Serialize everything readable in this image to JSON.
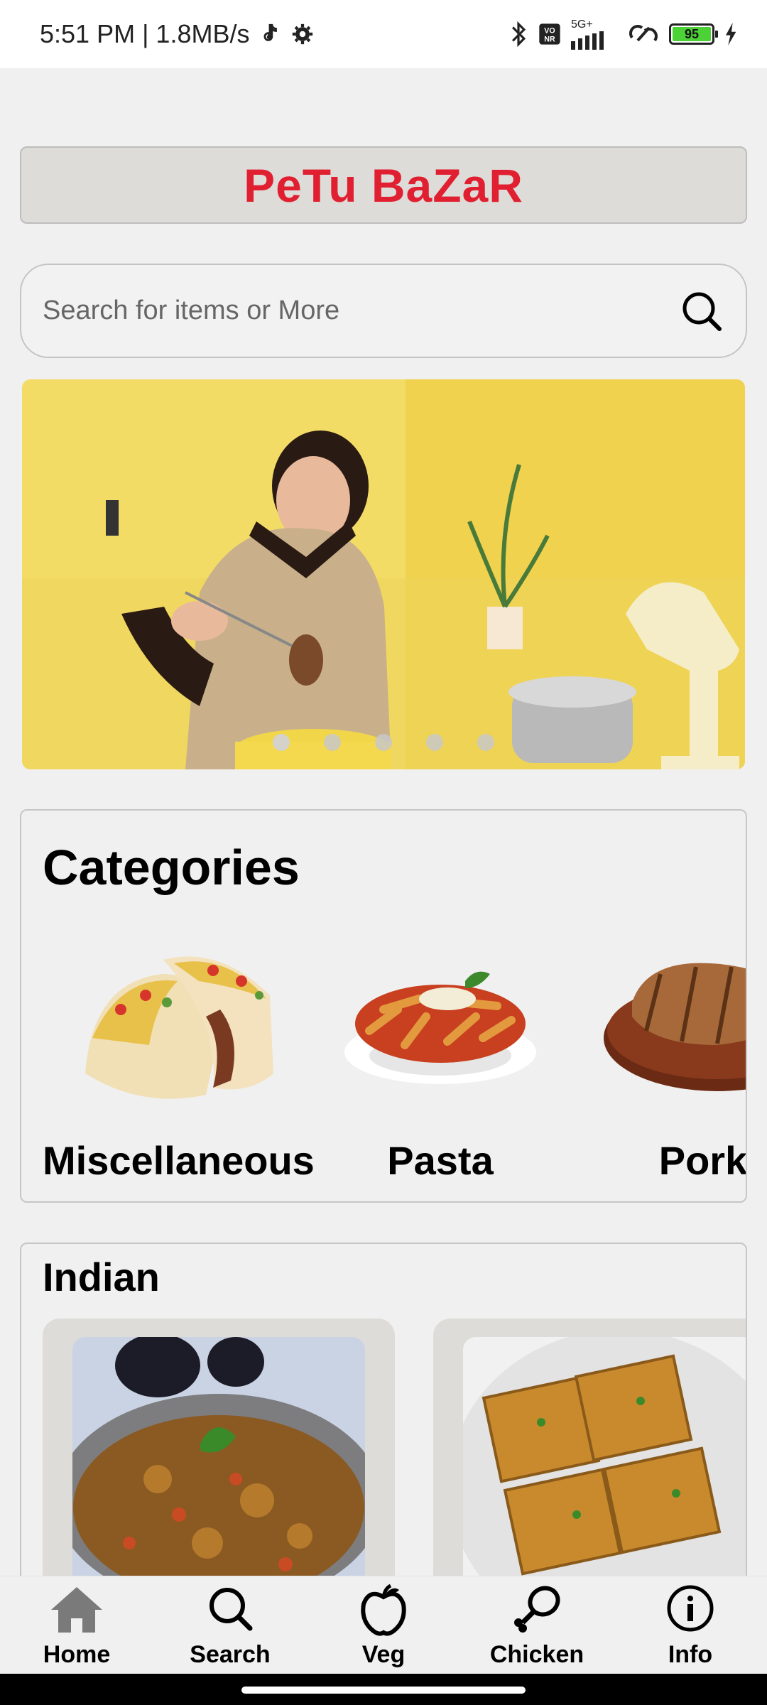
{
  "status_bar": {
    "time_speed": "5:51 PM | 1.8MB/s",
    "network": "5G+",
    "battery": "95"
  },
  "app": {
    "title": "PeTu BaZaR"
  },
  "search": {
    "placeholder": "Search for items or More"
  },
  "banner": {
    "slides": 5,
    "active_slide": 1
  },
  "categories": {
    "title": "Categories",
    "items": [
      {
        "label": "Miscellaneous",
        "icon": "taco-image"
      },
      {
        "label": "Pasta",
        "icon": "pasta-image"
      },
      {
        "label": "Pork",
        "icon": "pork-chop-image"
      }
    ]
  },
  "indian": {
    "title": "Indian",
    "items": [
      {
        "icon": "baingan-bharta-image"
      },
      {
        "icon": "bread-toast-image"
      }
    ]
  },
  "bottom_nav": {
    "items": [
      {
        "label": "Home",
        "icon": "home-icon"
      },
      {
        "label": "Search",
        "icon": "search-icon"
      },
      {
        "label": "Veg",
        "icon": "apple-icon"
      },
      {
        "label": "Chicken",
        "icon": "drumstick-icon"
      },
      {
        "label": "Info",
        "icon": "info-icon"
      }
    ]
  },
  "colors": {
    "title_red": "#e02030",
    "background": "#f1f0f0",
    "title_box": "#dedcd9"
  }
}
